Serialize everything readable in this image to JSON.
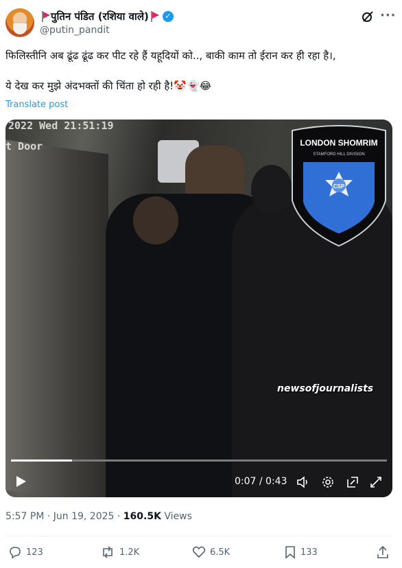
{
  "author": {
    "display_name": "पुतिन पंडित (रशिया वाले)",
    "handle": "@putin_pandit"
  },
  "post": {
    "line1": "फिलिस्तीनि अब ढूंढ ढूंढ कर पीट रहे हैं यहूदियों को.., बाकी काम तो ईरान कर ही रहा है।,",
    "line2": "ये देख कर मुझे अंदभक्तों की चिंता हो रही है!🤡👻😂",
    "translate_label": "Translate post"
  },
  "video": {
    "timestamp_overlay": "2022 Wed 21:51:19",
    "door_overlay": "t Door",
    "badge_text": "LONDON SHOMRIM",
    "badge_sub": "STAMFORD HILL DIVISION",
    "badge_emblem": "CSP",
    "watermark": "newsofjournalists",
    "time_display": "0:07 / 0:43",
    "progress_fraction": 0.163
  },
  "meta": {
    "time": "5:57 PM · Jun 19, 2025 · ",
    "views_count": "160.5K",
    "views_label": " Views"
  },
  "actions": {
    "replies": "123",
    "reposts": "1.2K",
    "likes": "6.5K",
    "bookmarks": "133"
  }
}
